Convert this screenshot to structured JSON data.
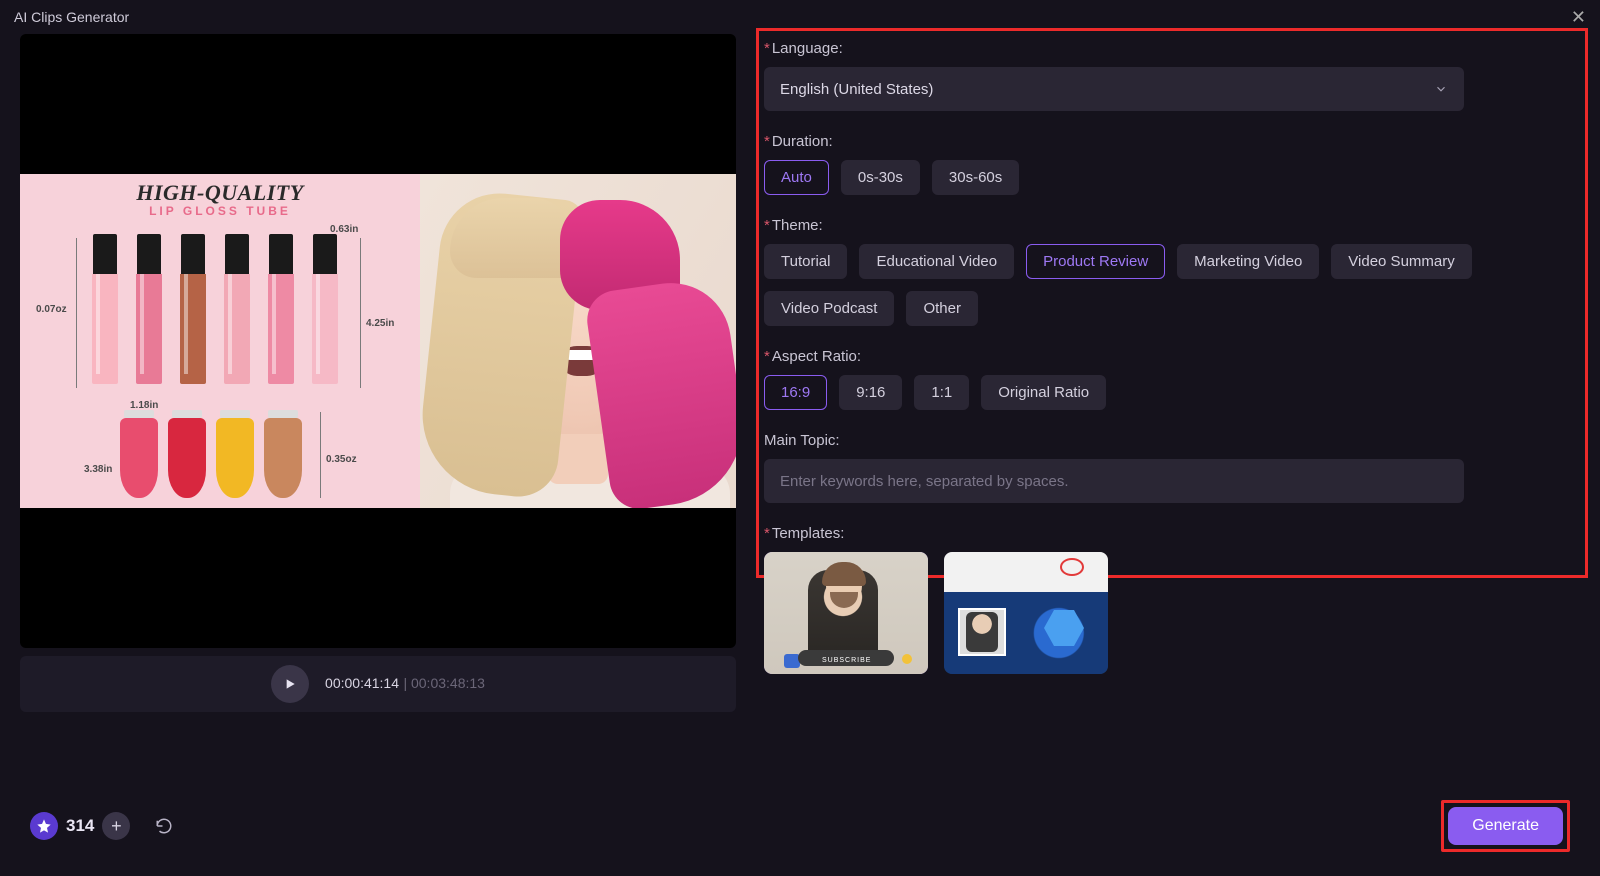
{
  "window": {
    "title": "AI Clips Generator"
  },
  "preview": {
    "headline": "HIGH-QUALITY",
    "subhead": "LIP GLOSS TUBE",
    "dims": {
      "oz1": "0.07oz",
      "top_in": "0.63in",
      "height_in": "4.25in",
      "width_in": "1.18in",
      "bottom_in": "3.38in",
      "oz2": "0.35oz"
    },
    "time_current": "00:00:41:14",
    "time_total": "00:03:48:13"
  },
  "form": {
    "language": {
      "label": "Language:",
      "value": "English (United States)"
    },
    "duration": {
      "label": "Duration:",
      "options": [
        "Auto",
        "0s-30s",
        "30s-60s"
      ],
      "selected": "Auto"
    },
    "theme": {
      "label": "Theme:",
      "options": [
        "Tutorial",
        "Educational Video",
        "Product Review",
        "Marketing Video",
        "Video Summary",
        "Video Podcast",
        "Other"
      ],
      "selected": "Product Review"
    },
    "aspect": {
      "label": "Aspect Ratio:",
      "options": [
        "16:9",
        "9:16",
        "1:1",
        "Original Ratio"
      ],
      "selected": "16:9"
    },
    "topic": {
      "label": "Main Topic:",
      "placeholder": "Enter keywords here, separated by spaces.",
      "value": ""
    },
    "templates": {
      "label": "Templates:",
      "selected_index": 0,
      "items": [
        {
          "caption": "SUBSCRIBE"
        },
        {
          "caption": ""
        }
      ]
    }
  },
  "footer": {
    "credits": "314",
    "generate": "Generate"
  }
}
